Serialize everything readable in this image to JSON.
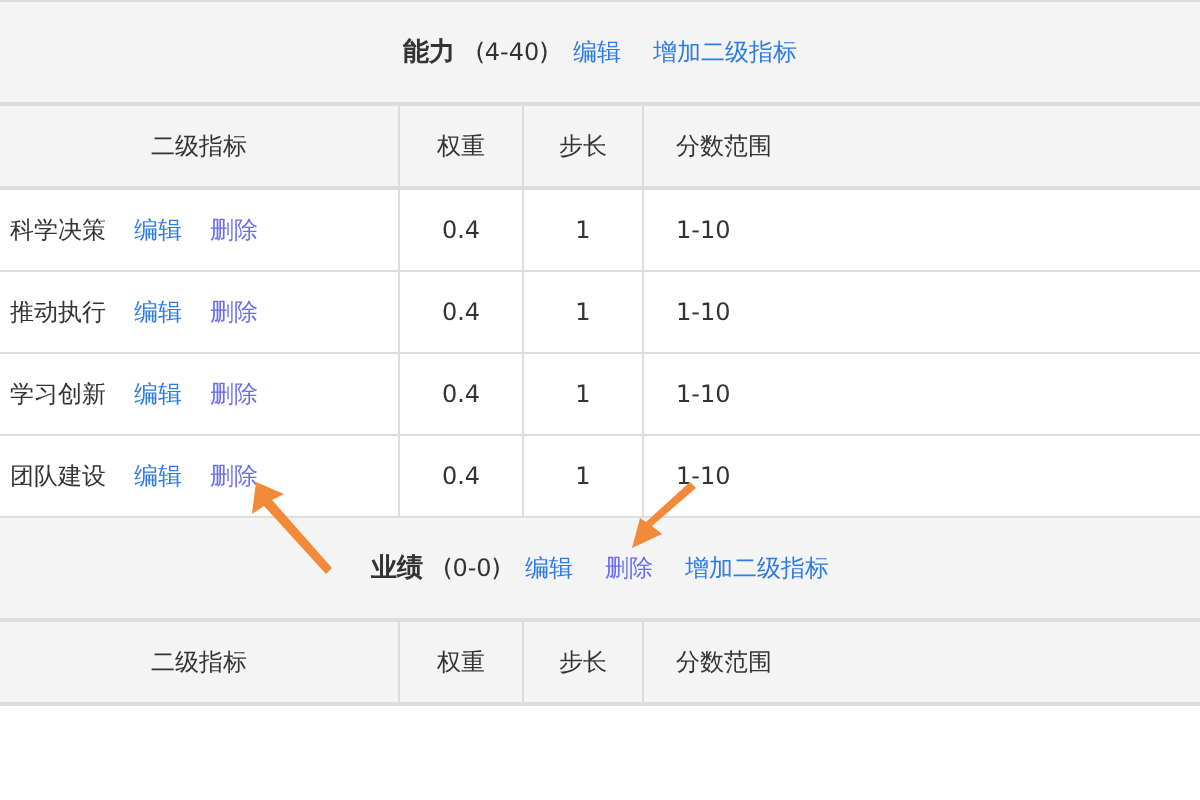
{
  "groups": [
    {
      "title": "能力",
      "range": "(4-40)",
      "actions": [
        {
          "label": "编辑",
          "kind": "edit"
        },
        {
          "label": "增加二级指标",
          "kind": "add"
        }
      ],
      "columns": [
        "二级指标",
        "权重",
        "步长",
        "分数范围"
      ],
      "rows": [
        {
          "name": "科学决策",
          "actions": [
            {
              "label": "编辑",
              "kind": "edit"
            },
            {
              "label": "删除",
              "kind": "delete"
            }
          ],
          "weight": "0.4",
          "step": "1",
          "score_range": "1-10"
        },
        {
          "name": "推动执行",
          "actions": [
            {
              "label": "编辑",
              "kind": "edit"
            },
            {
              "label": "删除",
              "kind": "delete"
            }
          ],
          "weight": "0.4",
          "step": "1",
          "score_range": "1-10"
        },
        {
          "name": "学习创新",
          "actions": [
            {
              "label": "编辑",
              "kind": "edit"
            },
            {
              "label": "删除",
              "kind": "delete"
            }
          ],
          "weight": "0.4",
          "step": "1",
          "score_range": "1-10"
        },
        {
          "name": "团队建设",
          "actions": [
            {
              "label": "编辑",
              "kind": "edit"
            },
            {
              "label": "删除",
              "kind": "delete"
            }
          ],
          "weight": "0.4",
          "step": "1",
          "score_range": "1-10"
        }
      ]
    },
    {
      "title": "业绩",
      "range": "(0-0)",
      "actions": [
        {
          "label": "编辑",
          "kind": "edit"
        },
        {
          "label": "删除",
          "kind": "delete"
        },
        {
          "label": "增加二级指标",
          "kind": "add"
        }
      ],
      "columns": [
        "二级指标",
        "权重",
        "步长",
        "分数范围"
      ]
    }
  ]
}
